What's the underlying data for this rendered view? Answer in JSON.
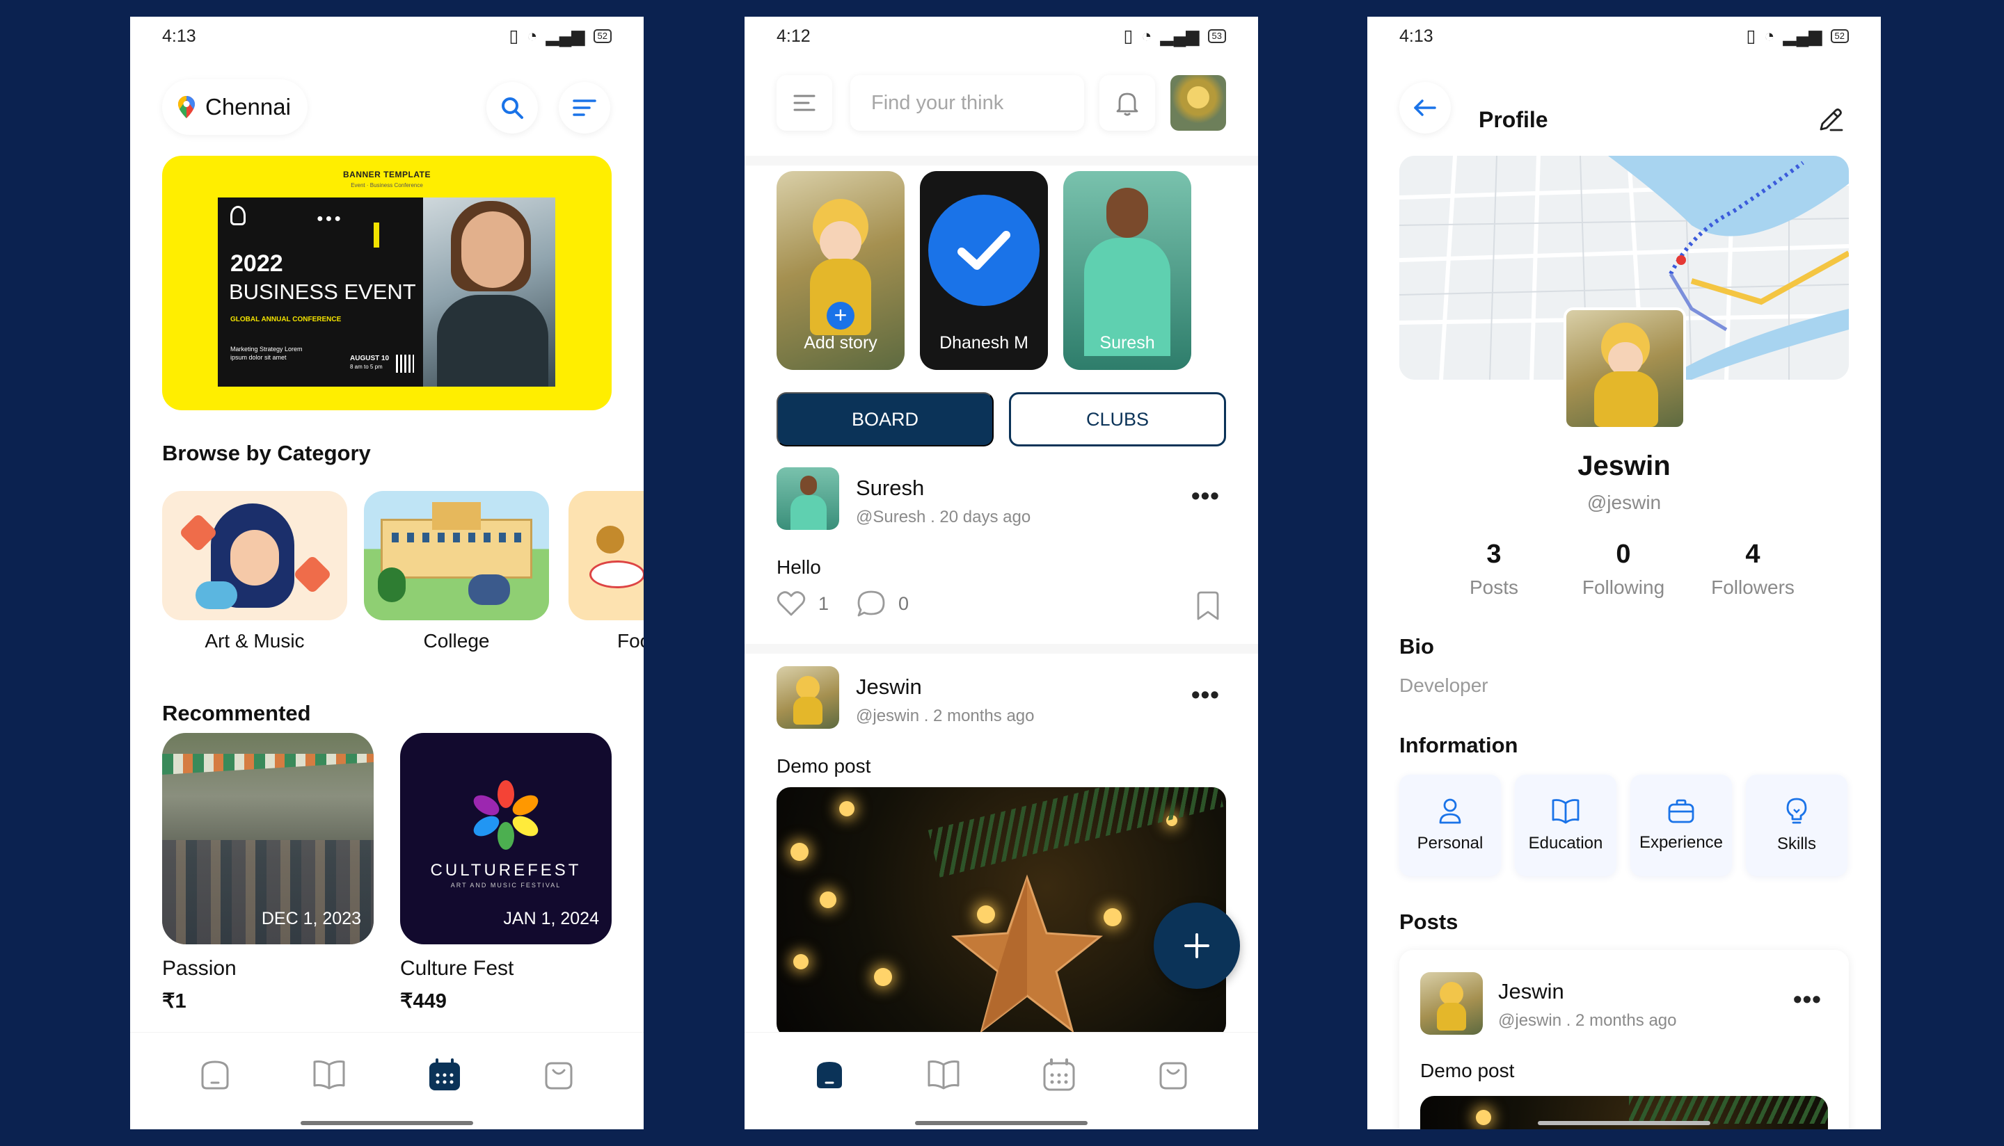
{
  "events_screen": {
    "status": {
      "time": "4:13",
      "battery": "52"
    },
    "location": "Chennai",
    "banner": {
      "header": "BANNER TEMPLATE",
      "subheader": "Event · Business Conference",
      "year": "2022",
      "title": "BUSINESS EVENT",
      "tagline": "GLOBAL ANNUAL CONFERENCE",
      "small_text": "Marketing Strategy Lorem ipsum dolor sit amet",
      "date_line1": "AUGUST 10",
      "date_line2": "8 am to 5 pm"
    },
    "browse_title": "Browse by Category",
    "categories": [
      {
        "label": "Art & Music"
      },
      {
        "label": "College"
      },
      {
        "label": "Foo"
      }
    ],
    "recommended_title": "Recommented",
    "recommended": [
      {
        "name": "Passion",
        "date": "DEC 1, 2023",
        "price": "₹1"
      },
      {
        "name": "Culture Fest",
        "date": "JAN 1, 2024",
        "price": "₹449",
        "logo_text": "CULTUREFEST",
        "logo_sub": "ART AND MUSIC FESTIVAL"
      }
    ],
    "nav": [
      "home-icon",
      "book-icon",
      "calendar-icon",
      "bag-icon"
    ],
    "active_nav": "calendar-icon"
  },
  "feed_screen": {
    "status": {
      "time": "4:12",
      "battery": "53"
    },
    "search_placeholder": "Find your think",
    "stories": [
      {
        "label": "Add story"
      },
      {
        "label": "Dhanesh M"
      },
      {
        "label": "Suresh"
      }
    ],
    "tabs": {
      "board": "BOARD",
      "clubs": "CLUBS"
    },
    "posts": [
      {
        "name": "Suresh",
        "meta": "@Suresh . 20 days ago",
        "text": "Hello",
        "likes": "1",
        "comments": "0"
      },
      {
        "name": "Jeswin",
        "meta": "@jeswin . 2 months ago",
        "text": "Demo post"
      }
    ],
    "nav": [
      "home-icon",
      "book-icon",
      "calendar-icon",
      "bag-icon"
    ],
    "active_nav": "home-icon"
  },
  "profile_screen": {
    "status": {
      "time": "4:13",
      "battery": "52"
    },
    "title": "Profile",
    "name": "Jeswin",
    "handle": "@jeswin",
    "stats": [
      {
        "value": "3",
        "label": "Posts"
      },
      {
        "value": "0",
        "label": "Following"
      },
      {
        "value": "4",
        "label": "Followers"
      }
    ],
    "bio_title": "Bio",
    "bio": "Developer",
    "info_title": "Information",
    "info": [
      {
        "label": "Personal",
        "icon": "user-icon"
      },
      {
        "label": "Education",
        "icon": "book-icon"
      },
      {
        "label": "Experience",
        "icon": "briefcase-icon"
      },
      {
        "label": "Skills",
        "icon": "lightbulb-icon"
      }
    ],
    "posts_title": "Posts",
    "post": {
      "name": "Jeswin",
      "meta": "@jeswin . 2 months ago",
      "text": "Demo post"
    }
  },
  "colors": {
    "background": "#0b2250",
    "primary": "#0b3358",
    "accent_blue": "#1a73e8",
    "banner_yellow": "#ffee00"
  }
}
